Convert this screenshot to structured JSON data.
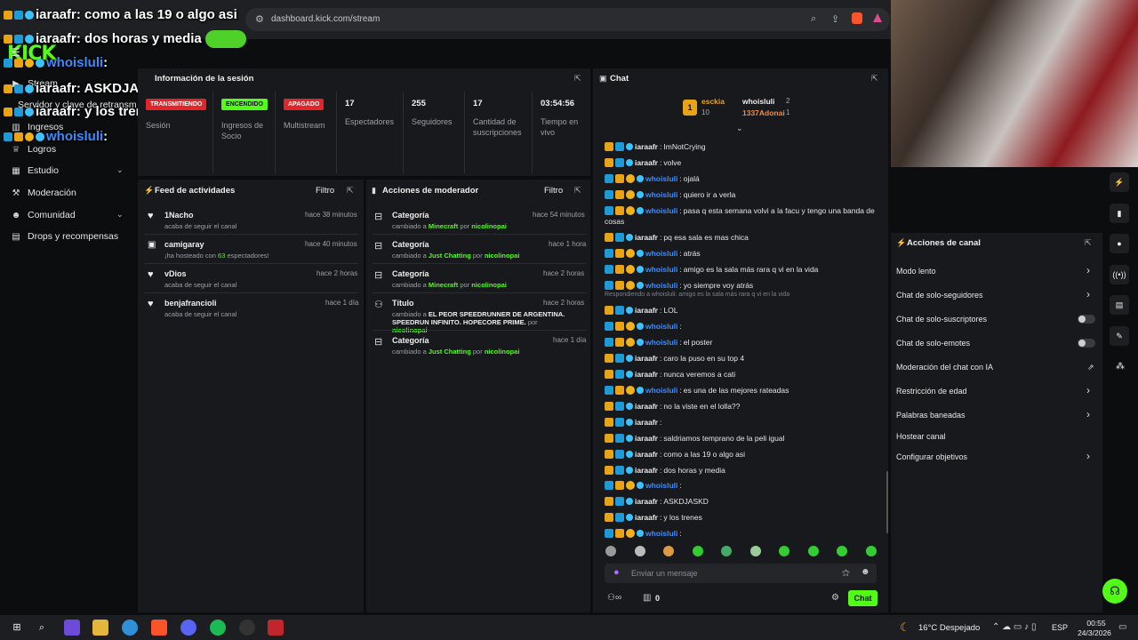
{
  "browser": {
    "url": "dashboard.kick.com/stream"
  },
  "overlay_chat": [
    {
      "user": "iaraafr",
      "text": "como a las 19 o algo asi"
    },
    {
      "user": "iaraafr",
      "text": "dos horas y media"
    },
    {
      "user": "whoisluli",
      "text": ""
    },
    {
      "user": "iaraafr",
      "text": "ASKDJASKD"
    },
    {
      "user": "iaraafr",
      "text": "y los trenes"
    },
    {
      "user": "whoisluli",
      "text": ""
    }
  ],
  "sidebar": {
    "logo": "KICK",
    "items": [
      {
        "label": "Stream"
      },
      {
        "label": "Servidor y clave de retransm"
      },
      {
        "label": "Ingresos"
      },
      {
        "label": "Logros"
      },
      {
        "label": "Estudio"
      },
      {
        "label": "Moderación"
      },
      {
        "label": "Comunidad"
      },
      {
        "label": "Drops y recompensas"
      }
    ]
  },
  "session": {
    "title": "Información de la sesión",
    "transmission_pill": "TRANSMITIENDO",
    "transmission_label": "Sesión",
    "partner_pill": "ENCENDIDO",
    "partner_label": "Ingresos de Socio",
    "multistream_pill": "APAGADO",
    "multistream_label": "Multistream",
    "viewers": "17",
    "viewers_label": "Espectadores",
    "followers": "255",
    "followers_label": "Seguidores",
    "subs": "17",
    "subs_label": "Cantidad de suscripciones",
    "uptime": "03:54:56",
    "uptime_label": "Tiempo en vivo"
  },
  "feed": {
    "title": "Feed de actividades",
    "filter": "Filtro",
    "items": [
      {
        "name": "1Nacho",
        "sub": "acaba de seguir el canal",
        "time": "hace 38 minutos"
      },
      {
        "name": "camigaray",
        "sub": "¡ha hosteado con 63 espectadores!",
        "time": "hace 40 minutos"
      },
      {
        "name": "vDios",
        "sub": "acaba de seguir el canal",
        "time": "hace 2 horas"
      },
      {
        "name": "benjafrancioli",
        "sub": "acaba de seguir el canal",
        "time": "hace 1 día"
      }
    ]
  },
  "modactions": {
    "title": "Acciones de moderador",
    "filter": "Filtro",
    "items": [
      {
        "name": "Categoría",
        "change": "cambiado a",
        "value": "Minecraft",
        "by": "por",
        "mod": "nicolinopai",
        "time": "hace 54 minutos"
      },
      {
        "name": "Categoría",
        "change": "cambiado a",
        "value": "Just Chatting",
        "by": "por",
        "mod": "nicolinopai",
        "time": "hace 1 hora"
      },
      {
        "name": "Categoría",
        "change": "cambiado a",
        "value": "Minecraft",
        "by": "por",
        "mod": "nicolinopai",
        "time": "hace 2 horas"
      },
      {
        "name": "Título",
        "change": "cambiado a",
        "value": "EL PEOR SPEEDRUNNER DE ARGENTINA. SPEEDRUN INFINITO. HOPECORE PRIME.",
        "by": "por",
        "mod": "nicolinopai",
        "time": "hace 2 horas"
      },
      {
        "name": "Categoría",
        "change": "cambiado a",
        "value": "Just Chatting",
        "by": "por",
        "mod": "nicolinopai",
        "time": "hace 1 día"
      }
    ]
  },
  "chat": {
    "title": "Chat",
    "top": [
      {
        "rank": "1",
        "name": "esckia",
        "score": "10"
      },
      {
        "name": "whoisluli",
        "score": "2"
      },
      {
        "name": "1337Adonai",
        "score": "1"
      }
    ],
    "messages": [
      {
        "user": "iaraafr",
        "text": "ImNotCrying"
      },
      {
        "user": "iaraafr",
        "text": "volve"
      },
      {
        "user": "whoisluli",
        "text": "ojalá"
      },
      {
        "user": "whoisluli",
        "text": "quiero ir a verla"
      },
      {
        "user": "whoisluli",
        "text": "pasa q esta semana volvi a la facu y tengo una banda de"
      },
      {
        "user": "",
        "text": "cosas"
      },
      {
        "user": "iaraafr",
        "text": "pq esa sala es mas chica"
      },
      {
        "user": "whoisluli",
        "text": "atrás"
      },
      {
        "user": "whoisluli",
        "text": "amigo es la sala más rara q vi en la vida"
      },
      {
        "user": "whoisluli",
        "text": "yo siempre voy atrás"
      },
      {
        "user": "iaraafr",
        "text": "LOL"
      },
      {
        "user": "whoisluli",
        "text": ""
      },
      {
        "user": "whoisluli",
        "text": "el poster"
      },
      {
        "user": "iaraafr",
        "text": "caro la puso en su top 4"
      },
      {
        "user": "iaraafr",
        "text": "nunca veremos a cati"
      },
      {
        "user": "whoisluli",
        "text": "es una de las mejores rateadas"
      },
      {
        "user": "iaraafr",
        "text": "no la viste en el lolla??"
      },
      {
        "user": "iaraafr",
        "text": ""
      },
      {
        "user": "iaraafr",
        "text": "saldriamos temprano de la peli igual"
      },
      {
        "user": "iaraafr",
        "text": "como a las 19 o algo asi"
      },
      {
        "user": "iaraafr",
        "text": "dos horas y media"
      },
      {
        "user": "whoisluli",
        "text": ""
      },
      {
        "user": "iaraafr",
        "text": "ASKDJASKD"
      },
      {
        "user": "iaraafr",
        "text": "y los trenes"
      },
      {
        "user": "whoisluli",
        "text": ""
      }
    ],
    "reply_note": "Respondiendo a whoisluli: amigo es la sala más rara q vi en la vida",
    "input_placeholder": "Enviar un mensaje",
    "points": "0",
    "send_label": "Chat"
  },
  "channel_actions": {
    "title": "Acciones de canal",
    "items": [
      {
        "label": "Modo lento"
      },
      {
        "label": "Chat de solo-seguidores"
      },
      {
        "label": "Chat de solo-suscriptores"
      },
      {
        "label": "Chat de solo-emotes"
      },
      {
        "label": "Moderación del chat con IA"
      },
      {
        "label": "Restricción de edad"
      },
      {
        "label": "Palabras baneadas"
      },
      {
        "label": "Hostear canal"
      },
      {
        "label": "Configurar objetivos"
      }
    ]
  },
  "taskbar": {
    "weather": "16°C Despejado",
    "lang": "ESP",
    "time": "00:55",
    "date": "24/3/2026"
  },
  "colors": {
    "accent": "#53fc18",
    "red": "#e0262b",
    "user_blue": "#3b8cff"
  }
}
